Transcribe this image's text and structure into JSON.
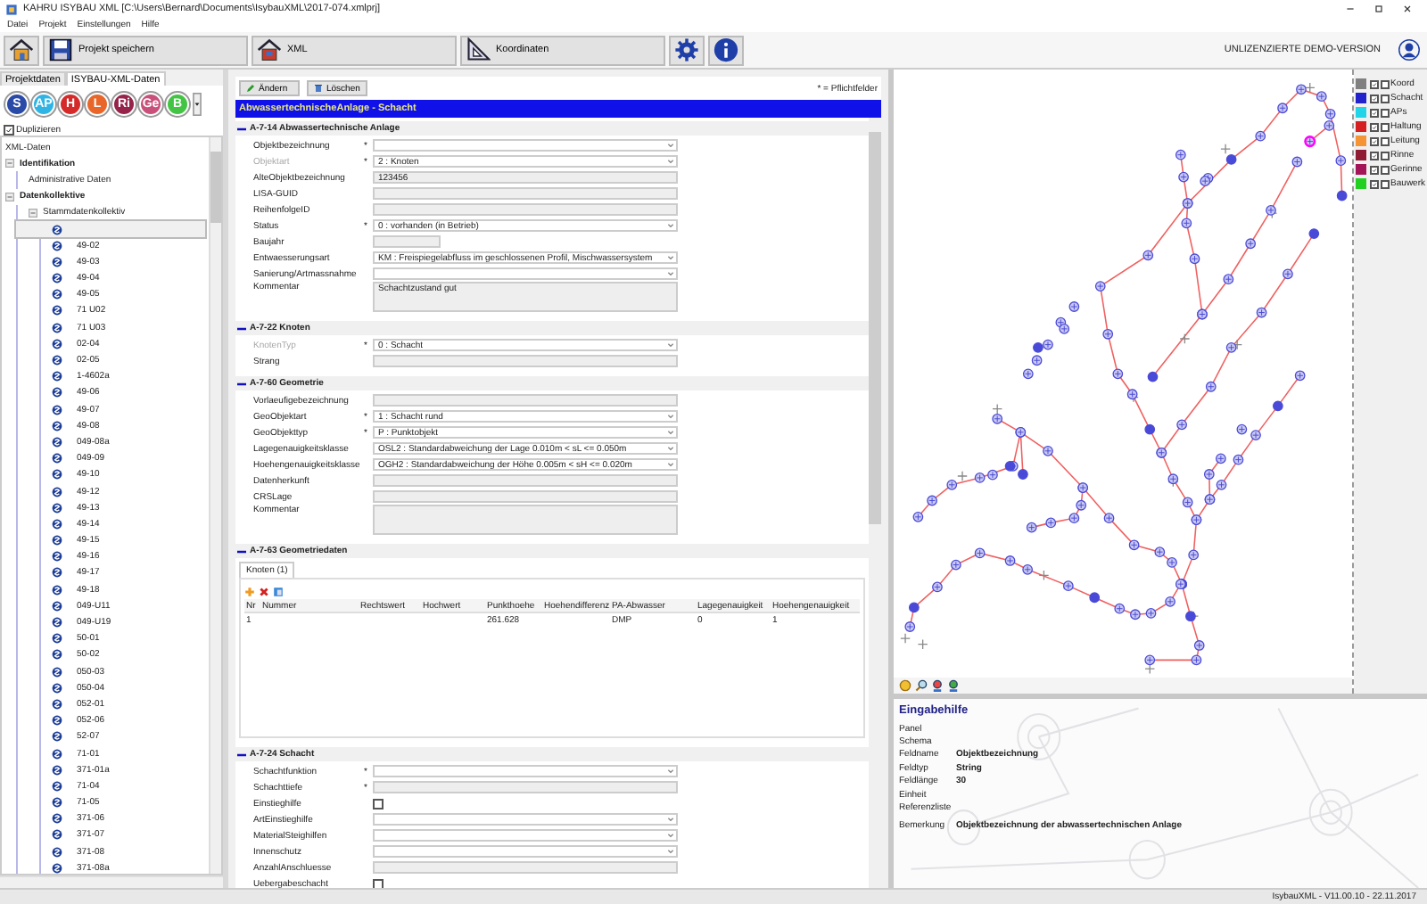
{
  "window": {
    "title": "KAHRU ISYBAU XML [C:\\Users\\Bernard\\Documents\\IsybauXML\\2017-074.xmlprj]"
  },
  "menu": [
    "Datei",
    "Projekt",
    "Einstellungen",
    "Hilfe"
  ],
  "toolbar": {
    "buttons": [
      {
        "kind": "home"
      },
      {
        "kind": "save",
        "label": "Projekt speichern"
      },
      {
        "kind": "xml",
        "label": "XML"
      },
      {
        "kind": "coords",
        "label": "Koordinaten"
      },
      {
        "kind": "settings"
      },
      {
        "kind": "info"
      }
    ],
    "license": "UNLIZENZIERTE DEMO-VERSION"
  },
  "left_panel": {
    "tabs": [
      {
        "label": "Projektdaten",
        "selected": false
      },
      {
        "label": "ISYBAU-XML-Daten",
        "selected": true
      }
    ],
    "type_buttons": [
      {
        "label": "S",
        "color": "#2a4aa8"
      },
      {
        "label": "AP",
        "color": "#30b4e4"
      },
      {
        "label": "H",
        "color": "#d42a2a"
      },
      {
        "label": "L",
        "color": "#e8662a"
      },
      {
        "label": "Ri",
        "color": "#96244a"
      },
      {
        "label": "Ge",
        "color": "#c8507a"
      },
      {
        "label": "B",
        "color": "#44c444"
      }
    ],
    "duplicate": {
      "label": "Duplizieren",
      "checked": true
    },
    "tree": {
      "label": "XML-Daten",
      "children": [
        {
          "kind": "group",
          "label": "Identifikation",
          "expanded": true,
          "children": [
            {
              "label": "Administrative Daten"
            }
          ]
        },
        {
          "kind": "group",
          "label": "Datenkollektive",
          "expanded": true,
          "children": [
            {
              "label": "Stammdatenkollektiv",
              "expanded": true,
              "children": [
                {
                  "kind": "record",
                  "selected": true
                },
                {
                  "kind": "record",
                  "label": "49-02",
                  "selected": false
                },
                {
                  "kind": "record",
                  "label": "49-03",
                  "selected": false
                },
                {
                  "kind": "record",
                  "label": "49-04",
                  "selected": false
                },
                {
                  "kind": "record",
                  "label": "49-05",
                  "selected": false
                },
                {
                  "kind": "record",
                  "label": "71 U02",
                  "selected": false
                },
                {
                  "kind": "record",
                  "label": "71 U03",
                  "selected": false
                },
                {
                  "kind": "record",
                  "label": "02-04",
                  "selected": false
                },
                {
                  "kind": "record",
                  "label": "02-05",
                  "selected": false
                },
                {
                  "kind": "record",
                  "label": "1-4602a",
                  "selected": false
                },
                {
                  "kind": "record",
                  "label": "49-06",
                  "selected": false
                },
                {
                  "kind": "record",
                  "label": "49-07",
                  "selected": false
                },
                {
                  "kind": "record",
                  "label": "49-08",
                  "selected": false
                },
                {
                  "kind": "record",
                  "label": "049-08a",
                  "selected": false
                },
                {
                  "kind": "record",
                  "label": "049-09",
                  "selected": false
                },
                {
                  "kind": "record",
                  "label": "49-10",
                  "selected": false
                },
                {
                  "kind": "record",
                  "label": "49-12",
                  "selected": false
                },
                {
                  "kind": "record",
                  "label": "49-13",
                  "selected": false
                },
                {
                  "kind": "record",
                  "label": "49-14",
                  "selected": false
                },
                {
                  "kind": "record",
                  "label": "49-15",
                  "selected": false
                },
                {
                  "kind": "record",
                  "label": "49-16",
                  "selected": false
                },
                {
                  "kind": "record",
                  "label": "49-17",
                  "selected": false
                },
                {
                  "kind": "record",
                  "label": "49-18",
                  "selected": false
                },
                {
                  "kind": "record",
                  "label": "049-U11",
                  "selected": false
                },
                {
                  "kind": "record",
                  "label": "049-U19",
                  "selected": false
                },
                {
                  "kind": "record",
                  "label": "50-01",
                  "selected": false
                },
                {
                  "kind": "record",
                  "label": "50-02",
                  "selected": false
                },
                {
                  "kind": "record",
                  "label": "050-03",
                  "selected": false
                },
                {
                  "kind": "record",
                  "label": "050-04",
                  "selected": false
                },
                {
                  "kind": "record",
                  "label": "052-01",
                  "selected": false
                },
                {
                  "kind": "record",
                  "label": "052-06",
                  "selected": false
                },
                {
                  "kind": "record",
                  "label": "52-07",
                  "selected": false
                },
                {
                  "kind": "record",
                  "label": "71-01",
                  "selected": false
                },
                {
                  "kind": "record",
                  "label": "371-01a",
                  "selected": false
                },
                {
                  "kind": "record",
                  "label": "71-04",
                  "selected": false
                },
                {
                  "kind": "record",
                  "label": "71-05",
                  "selected": false
                },
                {
                  "kind": "record",
                  "label": "371-06",
                  "selected": false
                },
                {
                  "kind": "record",
                  "label": "371-07",
                  "selected": false
                },
                {
                  "kind": "record",
                  "label": "371-08",
                  "selected": false
                },
                {
                  "kind": "record",
                  "label": "371-08a",
                  "selected": false
                }
              ]
            }
          ]
        }
      ]
    }
  },
  "editor": {
    "buttons": [
      {
        "kind": "edit",
        "label": "Ändern"
      },
      {
        "kind": "delete",
        "label": "Löschen"
      }
    ],
    "required_note": "* = Pflichtfelder",
    "title": "AbwassertechnischeAnlage - Schacht",
    "sections": [
      {
        "title": "A-7-14 Abwassertechnische Anlage",
        "expanded": true,
        "items": [
          {
            "kind": "select",
            "label": "Objektbezeichnung",
            "required_mark": "*",
            "disabled": false
          },
          {
            "kind": "select",
            "label": "Objektart",
            "required_mark": "*",
            "disabled": true,
            "value": "2 : Knoten"
          },
          {
            "kind": "text",
            "label": "AlteObjektbezeichnung",
            "disabled": false,
            "value": "123456"
          },
          {
            "kind": "text",
            "label": "LISA-GUID",
            "disabled": false
          },
          {
            "kind": "text",
            "label": "ReihenfolgeID",
            "disabled": false
          },
          {
            "kind": "select",
            "label": "Status",
            "required_mark": "*",
            "disabled": false,
            "value": "0 : vorhanden (in Betrieb)"
          },
          {
            "kind": "short",
            "label": "Baujahr",
            "disabled": false
          },
          {
            "kind": "select",
            "label": "Entwaesserungsart",
            "disabled": false,
            "value": "KM : Freispiegelabfluss im geschlossenen Profil, Mischwassersystem"
          },
          {
            "kind": "select",
            "label": "Sanierung/Artmassnahme",
            "disabled": false
          },
          {
            "kind": "area",
            "label": "Kommentar",
            "disabled": false,
            "value": "Schachtzustand gut"
          }
        ]
      },
      {
        "title": "A-7-22 Knoten",
        "expanded": true,
        "items": [
          {
            "kind": "select",
            "label": "KnotenTyp",
            "required_mark": "*",
            "disabled": true,
            "value": "0 : Schacht"
          },
          {
            "kind": "text",
            "label": "Strang",
            "disabled": false
          }
        ]
      },
      {
        "title": "A-7-60 Geometrie",
        "expanded": true,
        "items": [
          {
            "kind": "text",
            "label": "Vorlaeufigebezeichnung",
            "disabled": false
          },
          {
            "kind": "select",
            "label": "GeoObjektart",
            "required_mark": "*",
            "disabled": false,
            "value": "1 : Schacht rund"
          },
          {
            "kind": "select",
            "label": "GeoObjekttyp",
            "required_mark": "*",
            "disabled": false,
            "value": "P : Punktobjekt"
          },
          {
            "kind": "select",
            "label": "Lagegenauigkeitsklasse",
            "disabled": false,
            "value": "OSL2 : Standardabweichung der Lage 0.010m < sL <= 0.050m"
          },
          {
            "kind": "select",
            "label": "Hoehengenauigkeitsklasse",
            "disabled": false,
            "value": "OGH2 : Standardabweichung der Höhe 0.005m < sH <= 0.020m"
          },
          {
            "kind": "text",
            "label": "Datenherkunft",
            "disabled": false
          },
          {
            "kind": "text",
            "label": "CRSLage",
            "disabled": false
          },
          {
            "kind": "area",
            "label": "Kommentar",
            "disabled": false
          }
        ]
      },
      {
        "title": "A-7-63 Geometriedaten",
        "expanded": true,
        "items": [
          {
            "kind": "table",
            "tab": "Knoten (1)",
            "columns": [
              "Nr",
              "Nummer",
              "Rechtswert",
              "Hochwert",
              "Punkthoehe",
              "Hoehendifferenz",
              "PA-Abwasser",
              "Lagegenauigkeit",
              "Hoehengenauigkeit"
            ],
            "rows": [
              [
                "1",
                null,
                null,
                null,
                "261.628",
                null,
                "DMP",
                "0",
                "1"
              ]
            ]
          }
        ]
      },
      {
        "title": "A-7-24 Schacht",
        "expanded": true,
        "items": [
          {
            "kind": "select",
            "label": "Schachtfunktion",
            "required_mark": "*",
            "disabled": false
          },
          {
            "kind": "text",
            "label": "Schachttiefe",
            "required_mark": "*",
            "disabled": false
          },
          {
            "kind": "check",
            "label": "Einstieghilfe",
            "disabled": false,
            "checked": false
          },
          {
            "kind": "select",
            "label": "ArtEinstieghilfe",
            "disabled": false
          },
          {
            "kind": "select",
            "label": "MaterialSteighilfen",
            "disabled": false
          },
          {
            "kind": "select",
            "label": "Innenschutz",
            "disabled": false
          },
          {
            "kind": "text",
            "label": "AnzahlAnschluesse",
            "disabled": false
          },
          {
            "kind": "check",
            "label": "Uebergabeschacht",
            "disabled": false,
            "checked": false
          }
        ]
      }
    ]
  },
  "map": {
    "legend": [
      {
        "label": "Koord",
        "color": "#808080",
        "visible": true,
        "marked": false
      },
      {
        "label": "Schacht",
        "color": "#2222cc",
        "visible": true,
        "marked": false
      },
      {
        "label": "APs",
        "color": "#22d4e8",
        "visible": true,
        "marked": false
      },
      {
        "label": "Haltung",
        "color": "#d42020",
        "visible": true,
        "marked": false
      },
      {
        "label": "Leitung",
        "color": "#f49434",
        "visible": true,
        "marked": false
      },
      {
        "label": "Rinne",
        "color": "#901c34",
        "visible": true,
        "marked": false
      },
      {
        "label": "Gerinne",
        "color": "#a41458",
        "visible": true,
        "marked": false
      },
      {
        "label": "Bauwerk",
        "color": "#22d022",
        "visible": true,
        "marked": false
      }
    ],
    "tools": [
      {
        "kind": "pan"
      },
      {
        "kind": "zoom"
      },
      {
        "kind": "zoom-in"
      },
      {
        "kind": "zoom-out"
      }
    ]
  },
  "help": {
    "title": "Eingabehilfe",
    "rows": [
      {
        "label": "Panel"
      },
      {
        "label": "Schema"
      },
      {
        "label": "Feldname",
        "value": "Objektbezeichnung"
      },
      {
        "label": "Feldtyp",
        "value": "String"
      },
      {
        "label": "Feldlänge",
        "value": "30"
      },
      {
        "label": "Einheit"
      },
      {
        "label": "Referenzliste"
      },
      {
        "label": "Bemerkung",
        "value": "Objektbezeichnung der abwassertechnischen Anlage"
      }
    ]
  },
  "status_bar": "IsybauXML - V11.00.10 - 22.11.2017"
}
